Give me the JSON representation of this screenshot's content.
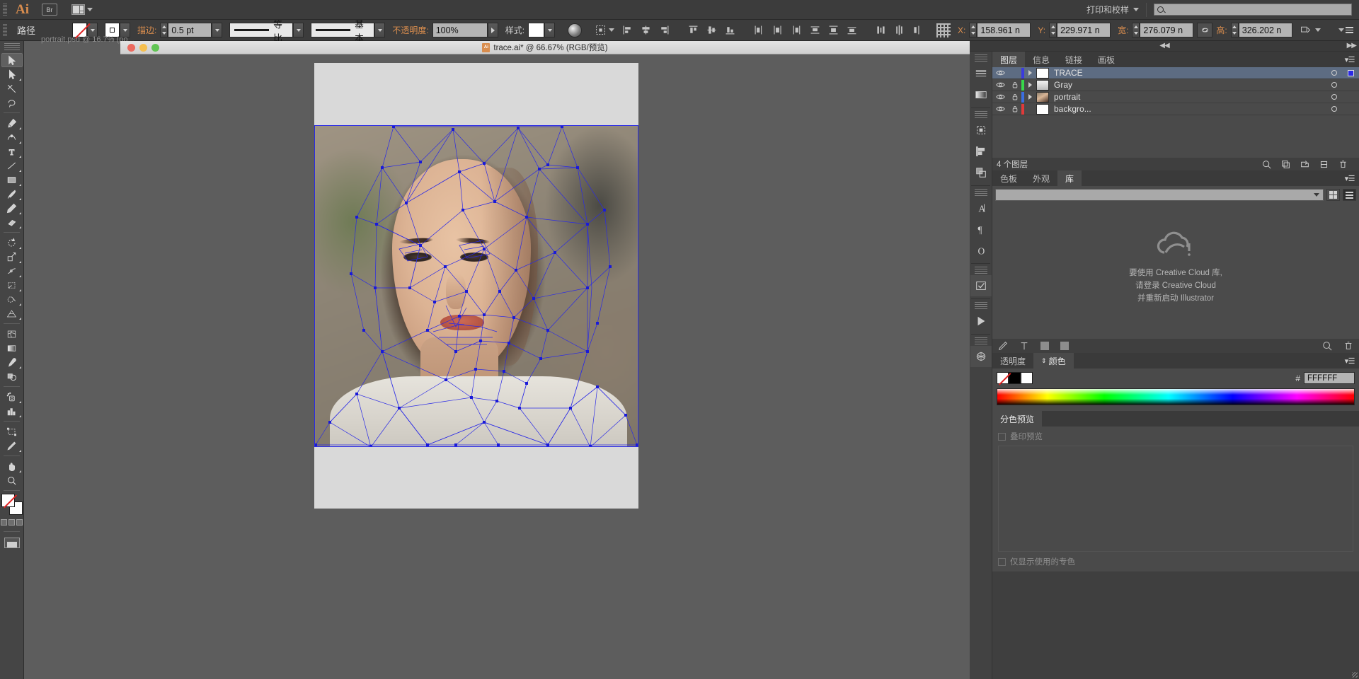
{
  "menubar": {
    "app_logo": "Ai",
    "bridge_label": "Br",
    "arrange_icon": "arrange-documents-icon",
    "workspace_label": "打印和校样",
    "search_placeholder": ""
  },
  "controlbar": {
    "object_type": "路径",
    "fill_icon": "fill-none-swatch",
    "stroke_icon": "stroke-swatch",
    "stroke_label": "描边:",
    "stroke_weight": "0.5 pt",
    "stroke_profile": "等比",
    "brush_definition": "基本",
    "opacity_label": "不透明度:",
    "opacity_value": "100%",
    "style_label": "样式:",
    "recolor_icon": "recolor-artwork-icon",
    "align_to_icon": "align-to-selection-icon",
    "x_label": "X:",
    "x_value": "158.961 n",
    "y_label": "Y:",
    "y_value": "229.971 n",
    "w_label": "宽:",
    "w_value": "276.079 n",
    "h_label": "高:",
    "h_value": "326.202 n",
    "link_icon": "constrain-proportions-icon",
    "transform_icon": "transform-options-icon",
    "panel_menu_icon": "panel-menu-icon",
    "align_icons": [
      "align-left-icon",
      "align-center-h-icon",
      "align-right-icon",
      "align-top-icon",
      "align-middle-v-icon",
      "align-bottom-icon",
      "distribute-left-icon",
      "distribute-center-h-icon",
      "distribute-right-icon",
      "distribute-top-icon",
      "distribute-middle-icon",
      "distribute-bottom-icon"
    ]
  },
  "toolbar": {
    "tools": [
      {
        "name": "selection-tool",
        "selected": true,
        "flyout": false
      },
      {
        "name": "direct-selection-tool",
        "selected": false,
        "flyout": true
      },
      {
        "name": "magic-wand-tool",
        "selected": false,
        "flyout": false
      },
      {
        "name": "lasso-tool",
        "selected": false,
        "flyout": false
      },
      {
        "name": "pen-tool",
        "selected": false,
        "flyout": true
      },
      {
        "name": "curvature-tool",
        "selected": false,
        "flyout": false
      },
      {
        "name": "type-tool",
        "selected": false,
        "flyout": true
      },
      {
        "name": "line-segment-tool",
        "selected": false,
        "flyout": true
      },
      {
        "name": "rectangle-tool",
        "selected": false,
        "flyout": true
      },
      {
        "name": "paintbrush-tool",
        "selected": false,
        "flyout": true
      },
      {
        "name": "pencil-tool",
        "selected": false,
        "flyout": true
      },
      {
        "name": "eraser-tool",
        "selected": false,
        "flyout": true
      },
      {
        "name": "rotate-tool",
        "selected": false,
        "flyout": true
      },
      {
        "name": "scale-tool",
        "selected": false,
        "flyout": true
      },
      {
        "name": "width-tool",
        "selected": false,
        "flyout": true
      },
      {
        "name": "free-transform-tool",
        "selected": false,
        "flyout": true
      },
      {
        "name": "shape-builder-tool",
        "selected": false,
        "flyout": true
      },
      {
        "name": "perspective-grid-tool",
        "selected": false,
        "flyout": true
      },
      {
        "name": "mesh-tool",
        "selected": false,
        "flyout": false
      },
      {
        "name": "gradient-tool",
        "selected": false,
        "flyout": false
      },
      {
        "name": "eyedropper-tool",
        "selected": false,
        "flyout": true
      },
      {
        "name": "blend-tool",
        "selected": false,
        "flyout": false
      },
      {
        "name": "symbol-sprayer-tool",
        "selected": false,
        "flyout": true
      },
      {
        "name": "column-graph-tool",
        "selected": false,
        "flyout": true
      },
      {
        "name": "artboard-tool",
        "selected": false,
        "flyout": false
      },
      {
        "name": "slice-tool",
        "selected": false,
        "flyout": true
      },
      {
        "name": "hand-tool",
        "selected": false,
        "flyout": true
      },
      {
        "name": "zoom-tool",
        "selected": false,
        "flyout": false
      }
    ],
    "fill_stroke_icon": "fill-and-stroke-swatches",
    "screen_mode_icon": "screen-mode-icon"
  },
  "document": {
    "ghost_tab": "portrait.psd @ 16.7% (po...",
    "title": "trace.ai* @ 66.67% (RGB/预览)",
    "zoom": "66.67%",
    "color_mode": "RGB/预览",
    "filename": "trace.ai*"
  },
  "panels": {
    "group1_tabs": [
      {
        "label": "图层",
        "active": true
      },
      {
        "label": "信息",
        "active": false
      },
      {
        "label": "链接",
        "active": false
      },
      {
        "label": "画板",
        "active": false
      }
    ],
    "layers": [
      {
        "name": "TRACE",
        "selected": true,
        "visible": true,
        "locked": false,
        "color": "#3a3ae0",
        "has_arrow": true,
        "has_target_square": true,
        "thumb": "white"
      },
      {
        "name": "Gray",
        "selected": false,
        "visible": true,
        "locked": true,
        "color": "#37d94a",
        "has_arrow": true,
        "has_target_square": false,
        "thumb": "gray"
      },
      {
        "name": "portrait",
        "selected": false,
        "visible": true,
        "locked": true,
        "color": "#3a6ee0",
        "has_arrow": true,
        "has_target_square": false,
        "thumb": "photo"
      },
      {
        "name": "backgro...",
        "selected": false,
        "visible": true,
        "locked": true,
        "color": "#e03a3a",
        "has_arrow": false,
        "has_target_square": false,
        "thumb": "white"
      }
    ],
    "layers_count": "4 个图层",
    "layers_footer_icons": [
      "locate-object-icon",
      "make-clipping-mask-icon",
      "create-new-sublayer-icon",
      "create-new-layer-icon",
      "delete-layer-icon"
    ],
    "group2_tabs": [
      {
        "label": "色板",
        "active": false
      },
      {
        "label": "外观",
        "active": false
      },
      {
        "label": "库",
        "active": true
      }
    ],
    "library": {
      "select_value": "",
      "grid_view_icon": "grid-view-icon",
      "list_view_icon": "list-view-icon",
      "cc_icon": "creative-cloud-icon",
      "message_line1": "要使用 Creative Cloud 库,",
      "message_line2": "请登录 Creative Cloud",
      "message_line3": "并重新启动 Illustrator",
      "footer_icons": [
        "add-graphic-icon",
        "add-text-icon",
        "add-fill-color-icon",
        "add-stroke-color-icon",
        "sync-icon",
        "delete-icon"
      ]
    },
    "group3_tabs": [
      {
        "label": "透明度",
        "active": false
      },
      {
        "label": "颜色",
        "active": true
      }
    ],
    "color": {
      "none_swatch": "none-swatch",
      "black_swatch": "black-swatch",
      "white_swatch": "white-swatch",
      "hex_symbol": "#",
      "hex_value": "FFFFFF",
      "spectrum_icon": "color-spectrum-ramp"
    },
    "group4_tabs": [
      {
        "label": "分色预览",
        "active": true
      }
    ],
    "separation": {
      "overprint_label": "叠印预览",
      "overprint_checked": false,
      "show_used_label": "仅显示使用的专色",
      "show_used_checked": false
    }
  },
  "colors": {
    "accent_orange": "#d98d4e",
    "mesh_blue": "#2a2ae6",
    "panel_bg": "#4a4a4a",
    "chrome_bg": "#3c3c3c",
    "canvas_bg": "#5d5d5d",
    "selection_blue": "#5d6c82"
  }
}
